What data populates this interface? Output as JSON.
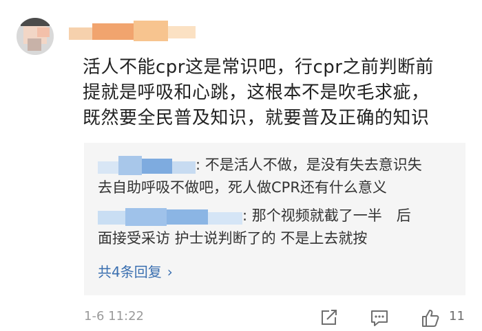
{
  "comment": {
    "lines": [
      "活人不能cpr这是常识吧，行cpr之前判断前",
      "提就是呼吸和心跳，这根本不是吹毛求疵，",
      "既然要全民普及知识，就要普及正确的知识"
    ],
    "time": "1-6 11:22",
    "like_count": "11"
  },
  "replies": [
    {
      "lines": [
        ": 不是活人不做，是没有失去意识失",
        "去自助呼吸不做吧，死人做CPR还有什么意义"
      ]
    },
    {
      "lines": [
        ": 那个视频就截了一半　后",
        "面接受采访  护士说判断了的  不是上去就按"
      ]
    }
  ],
  "more_replies": {
    "label": "共4条回复",
    "chevron": "›"
  },
  "colors": {
    "text": "#222222",
    "reply_bg": "#f5f5f5",
    "link": "#3a6fb0",
    "meta": "#9a9a9a"
  },
  "icons": [
    "share-icon",
    "comment-icon",
    "like-icon",
    "chevron-right-icon"
  ]
}
